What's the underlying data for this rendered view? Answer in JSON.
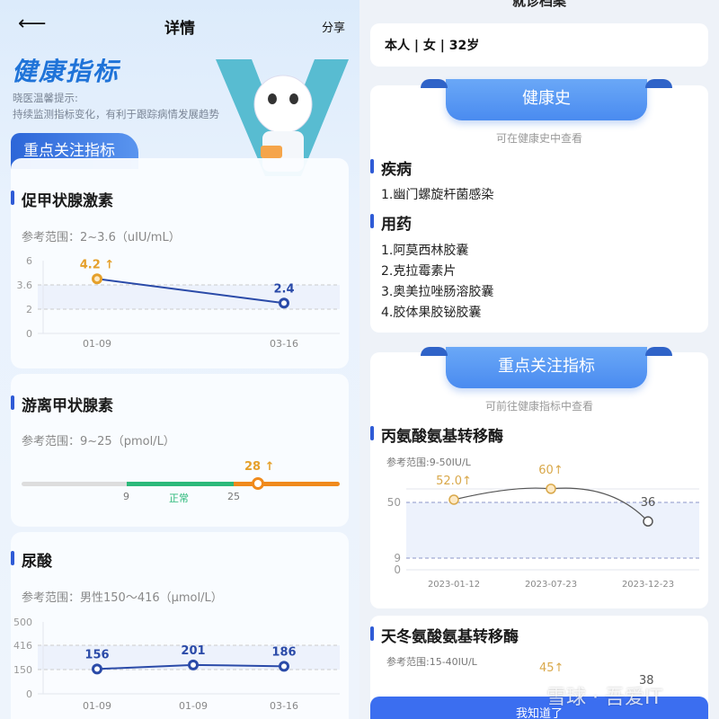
{
  "left": {
    "header": {
      "back_icon": "arrow-left-icon",
      "title": "详情",
      "share": "分享"
    },
    "hero": {
      "title": "健康指标",
      "tip_label": "晓医温馨提示:",
      "tip_text": "持续监测指标变化，有利于跟踪病情发展趋势",
      "mascot": "robot-doctor-mascot"
    },
    "tab": "重点关注指标",
    "indicators": [
      {
        "name": "促甲状腺激素",
        "ref": "参考范围：2~3.6（uIU/mL）"
      },
      {
        "name": "游离甲状腺素",
        "ref": "参考范围：9~25（pmol/L）",
        "range_low": "9",
        "range_high": "25",
        "normal_label": "正常",
        "value_label": "28 ↑",
        "value": 28
      },
      {
        "name": "尿酸",
        "ref": "参考范围：男性150～416（μmol/L）"
      }
    ]
  },
  "right": {
    "top_title": "就诊档案",
    "patient": "本人 | 女 | 32岁",
    "history": {
      "banner": "健康史",
      "subtitle": "可在健康史中查看",
      "disease_title": "疾病",
      "diseases": [
        "1.幽门螺旋杆菌感染"
      ],
      "medicine_title": "用药",
      "medicines": [
        "1.阿莫西林胶囊",
        "2.克拉霉素片",
        "3.奥美拉唑肠溶胶囊",
        "4.胶体果胶铋胶囊"
      ]
    },
    "key": {
      "banner": "重点关注指标",
      "subtitle": "可前往健康指标中查看",
      "indicators": [
        {
          "name": "丙氨酸氨基转移酶",
          "ref": "参考范围:9-50IU/L"
        },
        {
          "name": "天冬氨酸氨基转移酶",
          "ref": "参考范围:15-40IU/L",
          "value_labels": [
            "45↑",
            "38"
          ]
        }
      ]
    },
    "button": "我知道了",
    "watermark": "雪球 · 吾爱IT"
  },
  "colors": {
    "primary": "#2f5bd6",
    "high": "#e5a02a",
    "normal": "#2cb97a",
    "over": "#f08a1c"
  },
  "chart_data": [
    {
      "type": "line",
      "title": "促甲状腺激素",
      "categories": [
        "01-09",
        "03-16"
      ],
      "values": [
        4.2
      ],
      "labels": [
        "4.2 ↑",
        "2.4"
      ],
      "yticks": [
        "6",
        "3.6",
        "2",
        "0"
      ],
      "band": [
        2,
        3.6
      ],
      "series": [
        {
          "values": [
            4.2,
            2.4
          ]
        }
      ]
    },
    {
      "type": "line",
      "title": "尿酸",
      "categories": [
        "01-09",
        "01-09",
        "03-16"
      ],
      "labels": [
        "156",
        "201",
        "186"
      ],
      "yticks": [
        "500",
        "416",
        "150",
        "0"
      ],
      "band": [
        150,
        416
      ],
      "series": [
        {
          "values": [
            156,
            201,
            186
          ]
        }
      ]
    },
    {
      "type": "line",
      "title": "丙氨酸氨基转移酶",
      "categories": [
        "2023-01-12",
        "2023-07-23",
        "2023-12-23"
      ],
      "labels": [
        "52.0↑",
        "60↑",
        "36"
      ],
      "yticks": [
        "50",
        "9",
        "0"
      ],
      "band": [
        9,
        50
      ],
      "series": [
        {
          "values": [
            52,
            60,
            36
          ]
        }
      ]
    }
  ]
}
